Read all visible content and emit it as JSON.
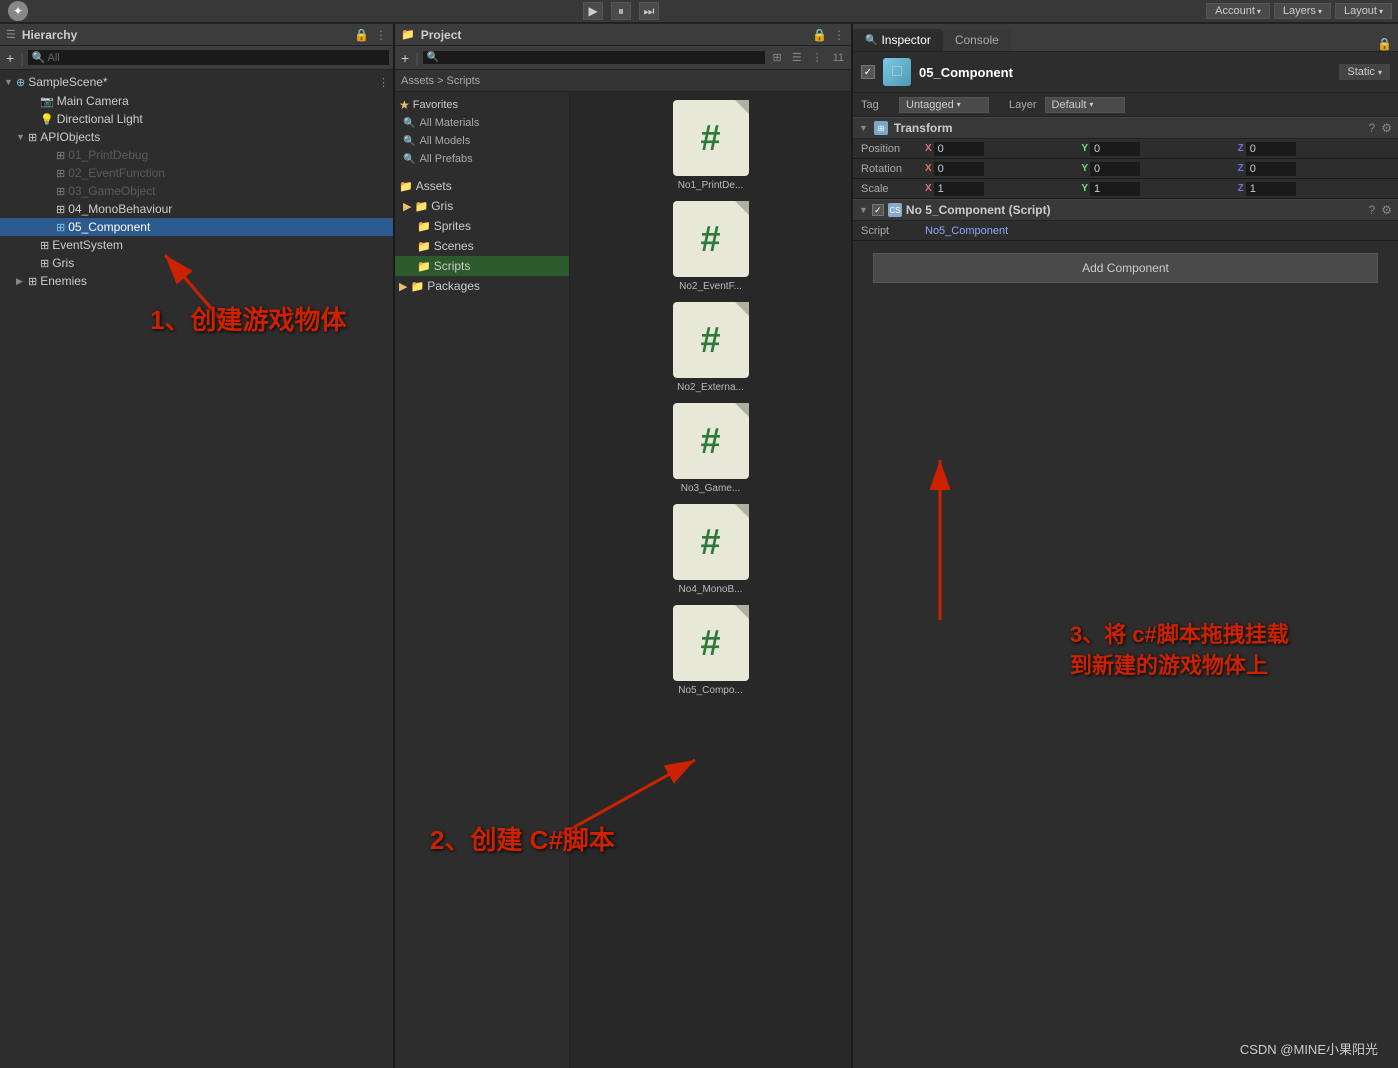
{
  "globalBar": {
    "account_label": "Account",
    "layers_label": "Layers",
    "layout_label": "Layout",
    "account_dropdown": "▾",
    "layers_dropdown": "▾",
    "layout_dropdown": "▾"
  },
  "toolbar": {
    "play": "▶",
    "pause": "⏸",
    "step": "⏭"
  },
  "hierarchy": {
    "title": "Hierarchy",
    "search_placeholder": "All",
    "scene_name": "SampleScene*",
    "items": [
      {
        "label": "Main Camera",
        "indent": 2,
        "type": "camera"
      },
      {
        "label": "Directional Light",
        "indent": 2,
        "type": "light"
      },
      {
        "label": "APIObjects",
        "indent": 2,
        "type": "folder",
        "expanded": true
      },
      {
        "label": "01_PrintDebug",
        "indent": 3,
        "type": "gameobj",
        "disabled": true
      },
      {
        "label": "02_EventFunction",
        "indent": 3,
        "type": "gameobj",
        "disabled": true
      },
      {
        "label": "03_GameObject",
        "indent": 3,
        "type": "gameobj",
        "disabled": true
      },
      {
        "label": "04_MonoBehaviour",
        "indent": 3,
        "type": "gameobj"
      },
      {
        "label": "05_Component",
        "indent": 3,
        "type": "gameobj",
        "selected": true
      },
      {
        "label": "EventSystem",
        "indent": 2,
        "type": "gameobj"
      },
      {
        "label": "Gris",
        "indent": 2,
        "type": "gameobj"
      },
      {
        "label": "Enemies",
        "indent": 2,
        "type": "folder"
      }
    ]
  },
  "project": {
    "title": "Project",
    "path": "Assets > Scripts",
    "favorites": [
      {
        "label": "All Materials"
      },
      {
        "label": "All Models"
      },
      {
        "label": "All Prefabs"
      }
    ],
    "folders": [
      {
        "label": "Assets",
        "expanded": true
      },
      {
        "label": "Gris",
        "indent": 1
      },
      {
        "label": "Sprites",
        "indent": 2
      },
      {
        "label": "Scenes",
        "indent": 2
      },
      {
        "label": "Scripts",
        "indent": 2
      },
      {
        "label": "Packages"
      }
    ],
    "scripts": [
      {
        "label": "No1_PrintDe..."
      },
      {
        "label": "No2_EventF..."
      },
      {
        "label": "No2_Externa..."
      },
      {
        "label": "No3_Game..."
      },
      {
        "label": "No4_MonoB..."
      },
      {
        "label": "No5_Compo..."
      }
    ]
  },
  "inspector": {
    "title": "Inspector",
    "console_label": "Console",
    "object_name": "05_Component",
    "static_label": "Static",
    "tag_label": "Tag",
    "tag_value": "Untagged",
    "layer_label": "Layer",
    "layer_value": "Default",
    "transform": {
      "title": "Transform",
      "position": {
        "label": "Position",
        "x": "0",
        "y": "0",
        "z": "0"
      },
      "rotation": {
        "label": "Rotation",
        "x": "0",
        "y": "0",
        "z": "0"
      },
      "scale": {
        "label": "Scale",
        "x": "1",
        "y": "1",
        "z": "1"
      }
    },
    "script_component": {
      "title": "No 5_Component (Script)",
      "script_label": "Script",
      "script_value": "No5_Component"
    },
    "add_component": "Add Component"
  },
  "annotations": {
    "annotation1": "1、创建游戏物体",
    "annotation2": "2、创建 C#脚本",
    "annotation3": "3、将 c#脚本拖拽挂载\n到新建的游戏物体上"
  },
  "credit": "CSDN @MINE小果阳光"
}
